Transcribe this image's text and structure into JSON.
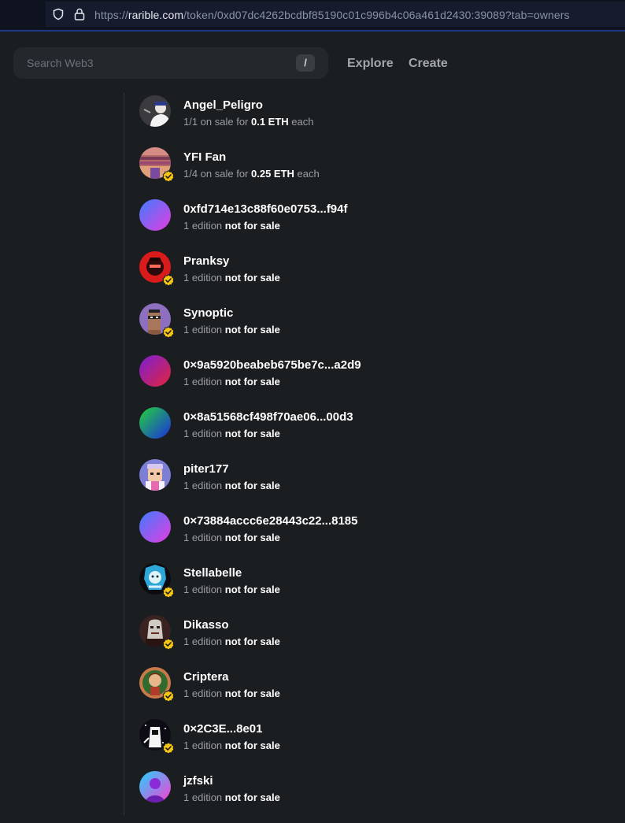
{
  "browser": {
    "url_prefix": "https://",
    "url_host": "rarible.com",
    "url_path": "/token/0xd07dc4262bcdbf85190c01c996b4c06a461d2430:39089?tab=owners"
  },
  "nav": {
    "search_placeholder": "Search Web3",
    "search_shortcut": "/",
    "explore": "Explore",
    "create": "Create"
  },
  "owners": [
    {
      "name": "Angel_Peligro",
      "pre": "1/1 on sale for ",
      "strong": "0.1 ETH",
      "post": " each",
      "verified": false,
      "avatar": "photo-angel"
    },
    {
      "name": "YFI Fan",
      "pre": "1/4 on sale for ",
      "strong": "0.25 ETH",
      "post": " each",
      "verified": true,
      "avatar": "photo-yfi"
    },
    {
      "name": "0xfd714e13c88f60e0753...f94f",
      "pre": "1 edition ",
      "strong": "not for sale",
      "post": "",
      "verified": false,
      "avatar": "gradient-blue-pink"
    },
    {
      "name": "Pranksy",
      "pre": "1 edition ",
      "strong": "not for sale",
      "post": "",
      "verified": true,
      "avatar": "photo-pranksy"
    },
    {
      "name": "Synoptic",
      "pre": "1 edition ",
      "strong": "not for sale",
      "post": "",
      "verified": true,
      "avatar": "photo-synoptic"
    },
    {
      "name": "0×9a5920beabeb675be7c...a2d9",
      "pre": "1 edition ",
      "strong": "not for sale",
      "post": "",
      "verified": false,
      "avatar": "gradient-purple-red"
    },
    {
      "name": "0×8a51568cf498f70ae06...00d3",
      "pre": "1 edition ",
      "strong": "not for sale",
      "post": "",
      "verified": false,
      "avatar": "gradient-green-blue"
    },
    {
      "name": "piter177",
      "pre": "1 edition ",
      "strong": "not for sale",
      "post": "",
      "verified": false,
      "avatar": "photo-piter"
    },
    {
      "name": "0×73884accc6e28443c22...8185",
      "pre": "1 edition ",
      "strong": "not for sale",
      "post": "",
      "verified": false,
      "avatar": "gradient-blue-pink"
    },
    {
      "name": "Stellabelle",
      "pre": "1 edition ",
      "strong": "not for sale",
      "post": "",
      "verified": true,
      "avatar": "photo-stellabelle"
    },
    {
      "name": "Dikasso",
      "pre": "1 edition ",
      "strong": "not for sale",
      "post": "",
      "verified": true,
      "avatar": "photo-dikasso"
    },
    {
      "name": "Criptera",
      "pre": "1 edition ",
      "strong": "not for sale",
      "post": "",
      "verified": true,
      "avatar": "photo-criptera"
    },
    {
      "name": "0×2C3E...8e01",
      "pre": "1 edition ",
      "strong": "not for sale",
      "post": "",
      "verified": true,
      "avatar": "photo-2c3e"
    },
    {
      "name": "jzfski",
      "pre": "1 edition ",
      "strong": "not for sale",
      "post": "",
      "verified": false,
      "avatar": "photo-jzfski"
    }
  ],
  "colors": {
    "background": "#1b1e21",
    "verified_badge": "#f5c518",
    "text_primary": "#ffffff",
    "text_secondary": "#9a9da3"
  }
}
